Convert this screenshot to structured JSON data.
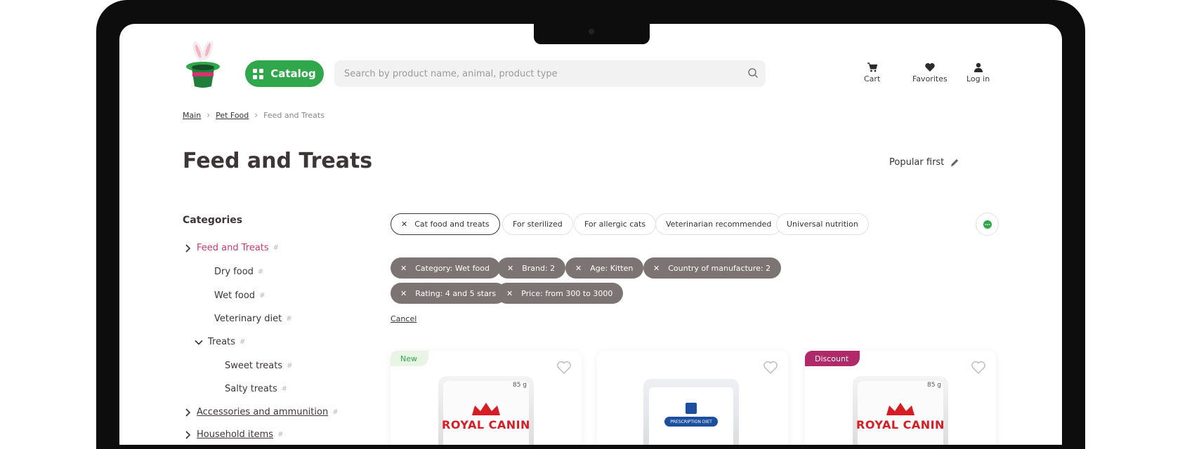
{
  "header": {
    "catalog_label": "Catalog",
    "search_placeholder": "Search by product name, animal, product type",
    "cart_label": "Cart",
    "favorites_label": "Favorites",
    "login_label": "Log in"
  },
  "breadcrumb": {
    "items": [
      "Main",
      "Pet Food",
      "Feed and Treats"
    ]
  },
  "page": {
    "title": "Feed and Treats",
    "sort_label": "Popular first"
  },
  "sidebar": {
    "heading": "Categories",
    "hash": "#",
    "items": [
      {
        "label": "Feed and Treats"
      },
      {
        "label": "Dry food"
      },
      {
        "label": "Wet food"
      },
      {
        "label": "Veterinary diet"
      },
      {
        "label": "Treats"
      },
      {
        "label": "Sweet treats"
      },
      {
        "label": "Salty treats"
      },
      {
        "label": "Accessories and ammunition"
      },
      {
        "label": "Household items"
      }
    ]
  },
  "quick_filters": [
    {
      "label": "Cat food and treats"
    },
    {
      "label": "For sterilized"
    },
    {
      "label": "For allergic cats"
    },
    {
      "label": "Veterinarian recommended"
    },
    {
      "label": "Universal nutrition"
    }
  ],
  "active_filters": [
    {
      "label": "Category: Wet food"
    },
    {
      "label": "Brand: 2"
    },
    {
      "label": "Age: Kitten"
    },
    {
      "label": "Country of manufacture: 2"
    },
    {
      "label": "Rating: 4 and 5 stars"
    },
    {
      "label": "Price: from 300 to 3000"
    }
  ],
  "cancel_label": "Cancel",
  "products": [
    {
      "badge": "New",
      "brand": "ROYAL CANIN",
      "weight": "85 g"
    },
    {
      "brand": "PRESCRIPTION DIET"
    },
    {
      "badge": "Discount",
      "brand": "ROYAL CANIN",
      "weight": "85 g"
    }
  ],
  "colors": {
    "accent": "#2fa74a",
    "active_category": "#c83a6e",
    "chip": "#7c7373",
    "discount": "#b02a6a"
  }
}
